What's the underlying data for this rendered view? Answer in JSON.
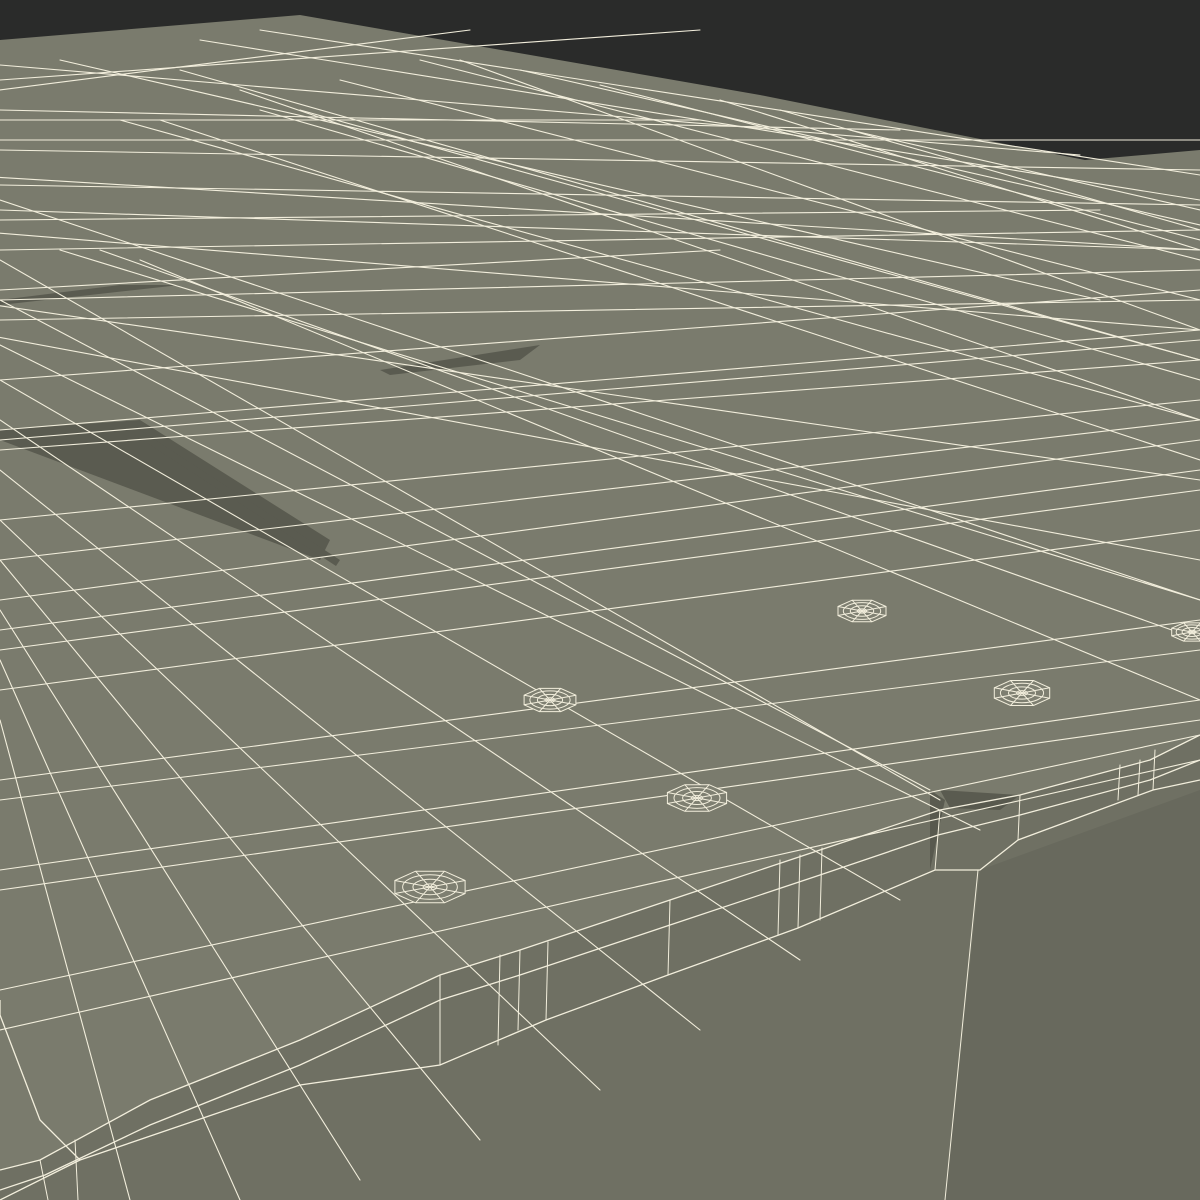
{
  "scene": {
    "subject": "wireframe-render",
    "colors": {
      "background": "#2a2b2a",
      "surface_top": "#7a7b6d",
      "surface_top_far": "#747567",
      "surface_side": "#6f7063",
      "surface_side_dark": "#66675b",
      "groove_shadow": "#55564b",
      "wire": "#f2eedc",
      "wire_soft": "#e6e2cf"
    },
    "icons": [
      "screw-head-icon"
    ]
  }
}
